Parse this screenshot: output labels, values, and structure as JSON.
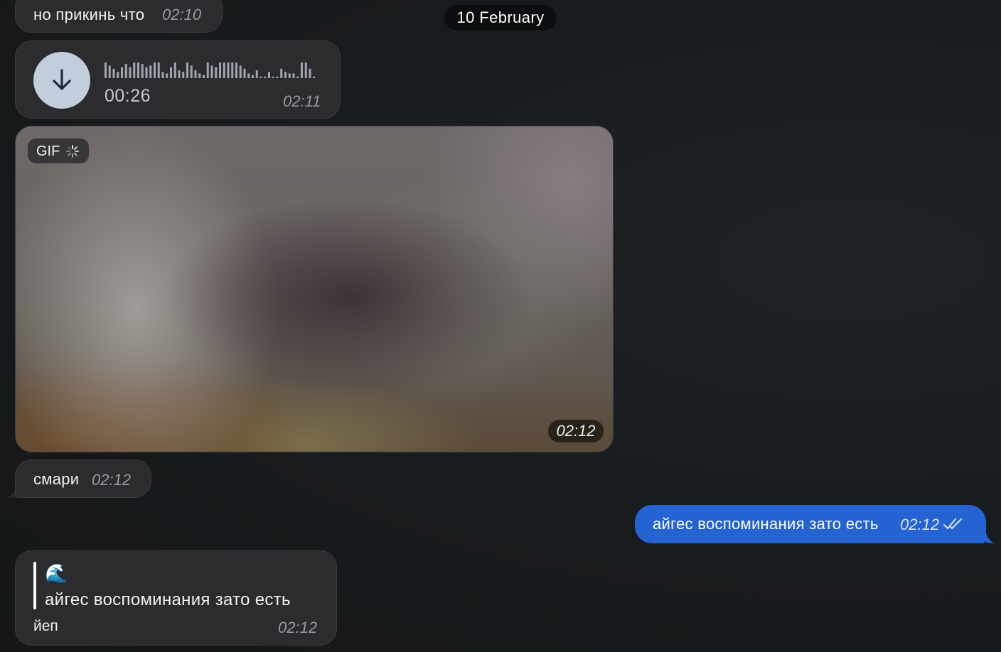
{
  "date_separator": "10 February",
  "messages": {
    "partial_top": {
      "text": "но прикинь что",
      "time": "02:10"
    },
    "voice": {
      "icon": "download-arrow-icon",
      "duration": "00:26",
      "time": "02:11"
    },
    "gif": {
      "badge_label": "GIF",
      "badge_icon": "loading-spinner-icon",
      "time": "02:12"
    },
    "smari": {
      "text": "смари",
      "time": "02:12"
    },
    "outgoing": {
      "text": "айгес воспоминания зато есть",
      "time": "02:12",
      "status_icon": "double-check-icon"
    },
    "reply": {
      "quote_emoji": "🌊",
      "quote_text": "айгес воспоминания зато есть",
      "text": "йеп",
      "time": "02:12"
    }
  },
  "colors": {
    "background": "#181b1d",
    "incoming_bubble": "#2c2c2e",
    "outgoing_bubble": "#2563d3",
    "date_pill": "#0c0d0e",
    "download_button": "#c3cedd"
  }
}
